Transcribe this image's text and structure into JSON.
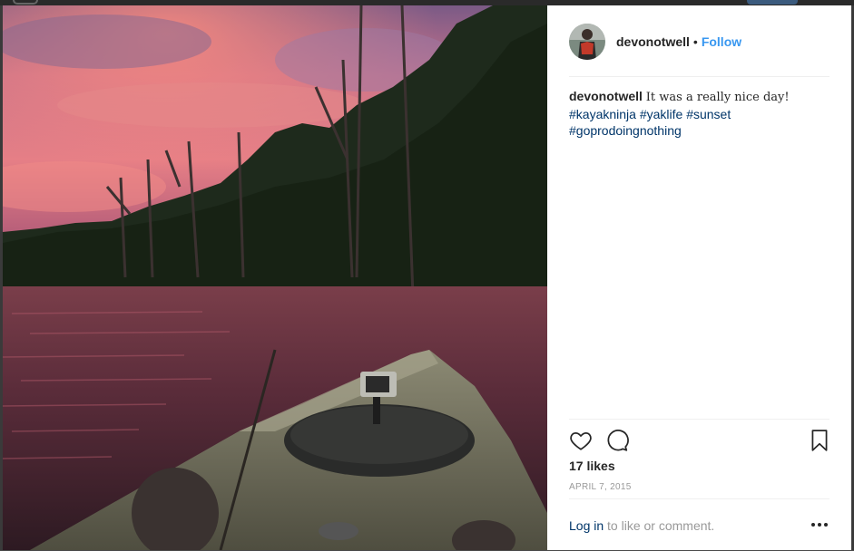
{
  "post": {
    "username": "devonotwell",
    "follow_label": "Follow",
    "separator": "•",
    "caption_text": "It was a really nice day!",
    "hashtags": [
      "#kayakninja",
      "#yaklife",
      "#sunset",
      "#goprodoingnothing"
    ],
    "likes": "17 likes",
    "date": "APRIL 7, 2015",
    "login_link": "Log in",
    "login_suffix": "to like or comment."
  },
  "icons": {
    "like": "heart-icon",
    "comment": "comment-icon",
    "save": "bookmark-icon",
    "more": "more-options-icon"
  },
  "colors": {
    "follow": "#3897f0",
    "hashtag": "#003569",
    "text": "#262626",
    "muted": "#999999"
  }
}
